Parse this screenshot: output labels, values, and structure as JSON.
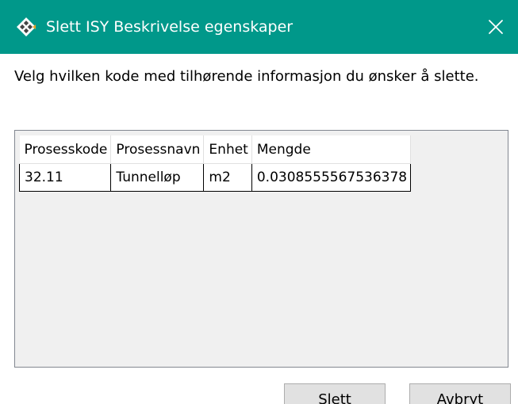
{
  "window": {
    "title": "Slett ISY Beskrivelse egenskaper",
    "close_icon": "close-icon",
    "app_icon": "isy-app-icon",
    "accent_color": "#00988a"
  },
  "message": "Velg hvilken kode med tilhørende informasjon du ønsker å slette.",
  "grid": {
    "columns": [
      "Prosesskode",
      "Prosessnavn",
      "Enhet",
      "Mengde"
    ],
    "rows": [
      [
        "32.11",
        "Tunnelløp",
        "m2",
        "0.0308555567536378"
      ]
    ]
  },
  "buttons": {
    "delete_label": "Slett",
    "cancel_label": "Avbryt"
  }
}
